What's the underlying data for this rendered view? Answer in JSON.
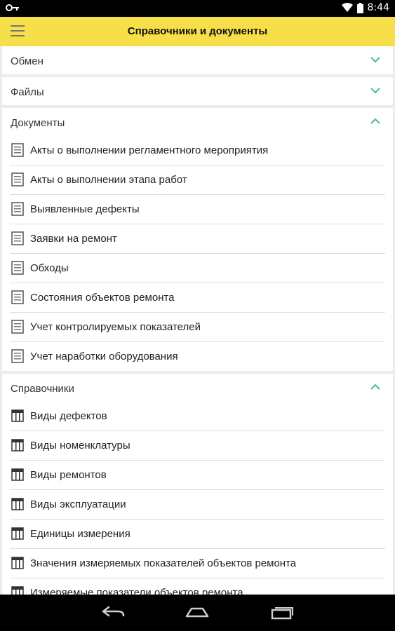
{
  "status": {
    "time": "8:44"
  },
  "appbar": {
    "title": "Справочники и документы"
  },
  "sections": {
    "exchange": {
      "label": "Обмен"
    },
    "files": {
      "label": "Файлы"
    },
    "documents": {
      "label": "Документы",
      "items": [
        "Акты о выполнении регламентного мероприятия",
        "Акты о выполнении этапа работ",
        "Выявленные дефекты",
        "Заявки на ремонт",
        "Обходы",
        "Состояния объектов ремонта",
        "Учет контролируемых показателей",
        "Учет наработки оборудования"
      ]
    },
    "catalogs": {
      "label": "Справочники",
      "items": [
        "Виды дефектов",
        "Виды номенклатуры",
        "Виды ремонтов",
        "Виды эксплуатации",
        "Единицы измерения",
        "Значения измеряемых показателей объектов ремонта",
        "Измеряемые показатели объектов ремонта"
      ]
    }
  },
  "colors": {
    "accent": "#f7df4a",
    "chevron": "#4fb3a4"
  },
  "icons": {
    "document": "document-icon",
    "catalog": "table-icon"
  }
}
